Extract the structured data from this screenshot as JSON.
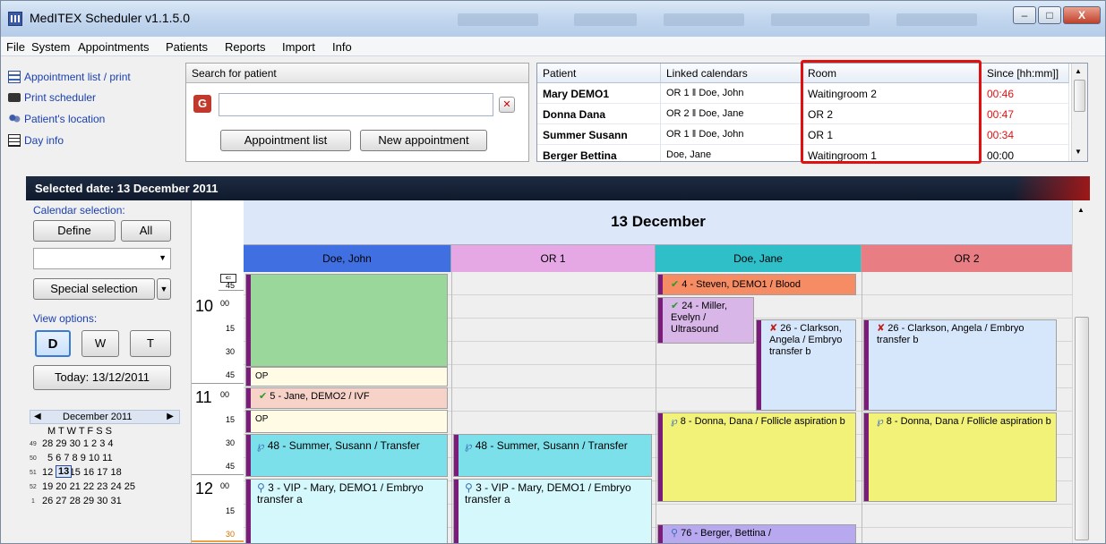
{
  "window": {
    "title": "MedITEX  Scheduler v1.1.5.0",
    "minimize": "–",
    "maximize": "□",
    "close": "X"
  },
  "menu": [
    "File",
    "System",
    "Appointments",
    "Patients",
    "Reports",
    "Import",
    "Info"
  ],
  "links": [
    {
      "label": "Appointment list / print",
      "icon": "list-icon"
    },
    {
      "label": "Print scheduler",
      "icon": "printer-icon"
    },
    {
      "label": "Patient's location",
      "icon": "people-icon"
    },
    {
      "label": "Day info",
      "icon": "note-icon"
    }
  ],
  "search": {
    "header": "Search for patient",
    "value": "",
    "appointment_list": "Appointment list",
    "new_appointment": "New appointment"
  },
  "patients_table": {
    "headers": [
      "Patient",
      "Linked calendars",
      "Room",
      "Since [hh:mm]]"
    ],
    "rows": [
      {
        "patient": "Mary DEMO1",
        "calendars": "OR 1 ‖ Doe, John",
        "room": "Waitingroom 2",
        "since": "00:46"
      },
      {
        "patient": "Donna Dana",
        "calendars": "OR 2 ‖ Doe, Jane",
        "room": "OR 2",
        "since": "00:47"
      },
      {
        "patient": "Summer Susann",
        "calendars": "OR 1 ‖ Doe, John",
        "room": "OR 1",
        "since": "00:34"
      },
      {
        "patient": "Berger Bettina",
        "calendars": "Doe, Jane",
        "room": "Waitingroom 1",
        "since": "00:00"
      }
    ]
  },
  "selected_date": "Selected date: 13 December 2011",
  "left_panel": {
    "calendar_selection": "Calendar selection:",
    "define": "Define",
    "all": "All",
    "special_selection": "Special selection",
    "view_options": "View options:",
    "view_d": "D",
    "view_w": "W",
    "view_t": "T",
    "today": "Today: 13/12/2011",
    "month": "December 2011",
    "weekdays": "M  T  W  T   F   S   S",
    "weeks": [
      {
        "no": "49",
        "days": "28 29 30  1   2   3   4"
      },
      {
        "no": "50",
        "days": "5   6   7   8   9 10 11"
      },
      {
        "no": "51",
        "days": "12        14 15 16 17 18"
      },
      {
        "no": "52",
        "days": "19 20 21 22 23 24 25"
      },
      {
        "no": "1",
        "days": "26 27 28 29 30 31"
      }
    ],
    "today_cell": "13"
  },
  "scheduler": {
    "day_title": "13 December",
    "columns": [
      {
        "label": "Doe, John",
        "color": "#3f6fe0"
      },
      {
        "label": "OR 1",
        "color": "#e5a8e5"
      },
      {
        "label": "Doe, Jane",
        "color": "#2fbfc8"
      },
      {
        "label": "OR 2",
        "color": "#e87e84"
      }
    ],
    "times": {
      "h10": "10",
      "h11": "11",
      "h12": "12",
      "m00": "00",
      "m15": "15",
      "m30": "30",
      "m45": "45",
      "m45top": "45"
    },
    "appointments": {
      "steven": "4 - Steven, DEMO1 / Blood",
      "miller": "24 - Miller, Evelyn / Ultrasound",
      "clarkson_jane": "26 - Clarkson, Angela / Embryo transfer b",
      "clarkson_or2": "26 - Clarkson, Angela / Embryo transfer b",
      "op1": "OP",
      "jane_demo2": "5 - Jane, DEMO2 / IVF",
      "op2": "OP",
      "donna_jane": "8 - Donna, Dana / Follicle aspiration b",
      "donna_or2": "8 - Donna, Dana / Follicle aspiration b",
      "summer_john": "48 - Summer, Susann / Transfer",
      "summer_or1": "48 - Summer, Susann / Transfer",
      "vip_john": "3 - VIP - Mary, DEMO1 / Embryo transfer a",
      "vip_or1": "3 - VIP - Mary, DEMO1 / Embryo transfer a",
      "berger": "76 - Berger, Bettina /"
    }
  }
}
